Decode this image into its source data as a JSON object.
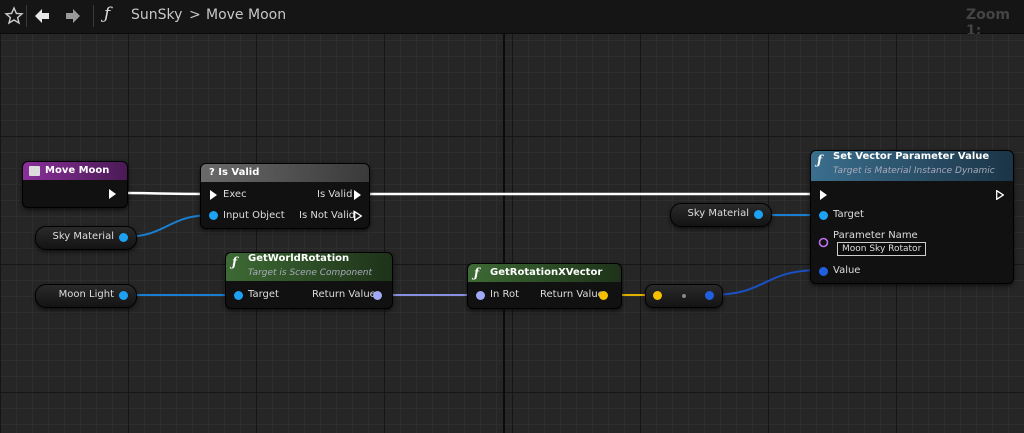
{
  "toolbar": {
    "favorite_icon": "star-icon",
    "back_icon": "arrow-left-icon",
    "forward_icon": "arrow-right-icon",
    "function_icon": "function-icon",
    "breadcrumb_root": "SunSky",
    "breadcrumb_sep": ">",
    "breadcrumb_current": "Move Moon",
    "zoom": "Zoom 1:"
  },
  "nodes": {
    "move_moon": {
      "title": "Move Moon",
      "color": "#7a2a8a"
    },
    "is_valid": {
      "title": "? Is Valid",
      "exec_in": "Exec",
      "input_object": "Input Object",
      "is_valid_out": "Is Valid",
      "is_not_valid_out": "Is Not Valid"
    },
    "get_world_rotation": {
      "title": "GetWorldRotation",
      "subtitle": "Target is Scene Component",
      "target": "Target",
      "return_value": "Return Value"
    },
    "get_rotation_x_vector": {
      "title": "GetRotationXVector",
      "in_rot": "In Rot",
      "return_value": "Return Value"
    },
    "set_vector_param": {
      "title": "Set Vector Parameter Value",
      "subtitle": "Target is Material Instance Dynamic",
      "target": "Target",
      "parameter_name_label": "Parameter Name",
      "parameter_name_value": "Moon Sky Rotator",
      "value": "Value"
    }
  },
  "variables": {
    "sky_material_left": "Sky Material",
    "sky_material_right": "Sky Material",
    "moon_light": "Moon Light"
  },
  "colors": {
    "object_pin": "#1da1f2",
    "rotator_pin": "#a0a8f8",
    "vector_pin": "#f5c000",
    "vector_out_pin": "#2060e0",
    "name_pin": "#c070f0",
    "exec": "#ffffff"
  }
}
